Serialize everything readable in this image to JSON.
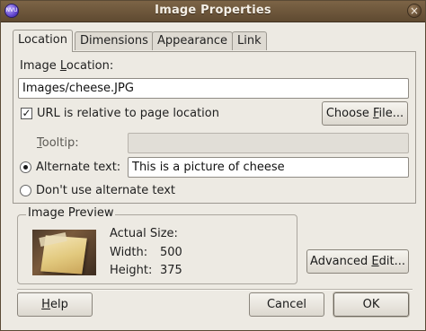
{
  "window": {
    "title": "Image Properties",
    "app_icon": "nvu-app-icon",
    "close_icon": "close-icon"
  },
  "tabs": [
    {
      "label": "Location",
      "active": true
    },
    {
      "label": "Dimensions",
      "active": false
    },
    {
      "label": "Appearance",
      "active": false
    },
    {
      "label": "Link",
      "active": false
    }
  ],
  "location": {
    "image_location_label_pre": "Image ",
    "image_location_label_accel": "L",
    "image_location_label_post": "ocation:",
    "image_location_value": "Images/cheese.JPG",
    "url_relative_label": "URL is relative to page location",
    "url_relative_checked": true,
    "choose_file_pre": "Choose ",
    "choose_file_accel": "F",
    "choose_file_post": "ile...",
    "tooltip_label_accel": "T",
    "tooltip_label_post": "ooltip:",
    "tooltip_value": "",
    "alt_text_label": "Alternate text:",
    "alt_text_checked": true,
    "alt_text_value": "This is a picture of cheese",
    "no_alt_label": "Don't use alternate text",
    "no_alt_checked": false
  },
  "preview": {
    "group_title": "Image Preview",
    "actual_size_label": "Actual Size:",
    "width_label": "Width:",
    "width_value": "500",
    "height_label": "Height:",
    "height_value": "375"
  },
  "buttons": {
    "advanced_pre": "Advanced ",
    "advanced_accel": "E",
    "advanced_post": "dit...",
    "help_accel": "H",
    "help_post": "elp",
    "cancel": "Cancel",
    "ok": "OK"
  }
}
